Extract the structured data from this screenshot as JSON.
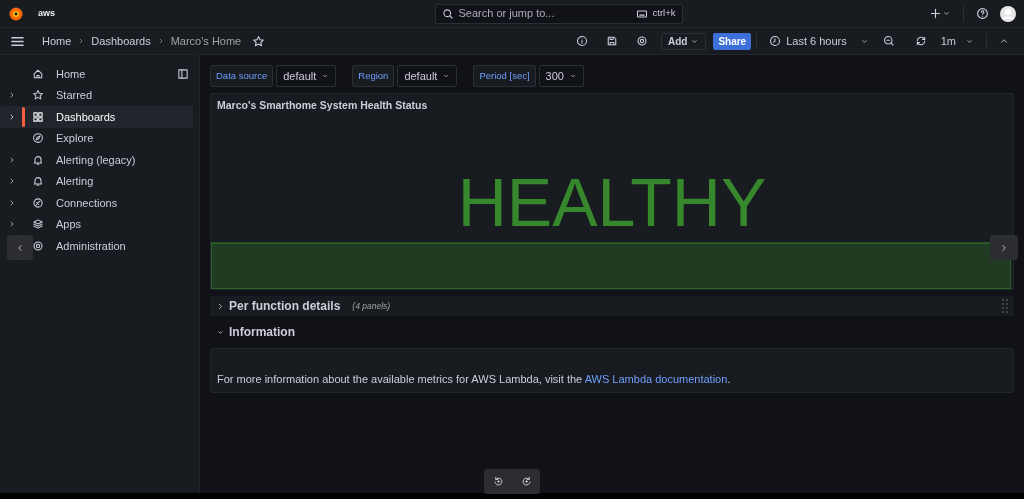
{
  "topbar": {
    "logo_text": "aws",
    "search": {
      "placeholder": "Search or jump to..."
    },
    "shortcut": "ctrl+k"
  },
  "breadcrumbs": [
    {
      "label": "Home",
      "current": false
    },
    {
      "label": "Dashboards",
      "current": false
    },
    {
      "label": "Marco's Home",
      "current": true
    }
  ],
  "toolbar": {
    "add_button": "Add",
    "share_button": "Share",
    "time_range": "Last 6 hours",
    "refresh_interval": "1m"
  },
  "sidebar": {
    "items": [
      {
        "label": "Home",
        "selected": false,
        "expandable": false
      },
      {
        "label": "Starred",
        "selected": false,
        "expandable": true
      },
      {
        "label": "Dashboards",
        "selected": true,
        "expandable": true
      },
      {
        "label": "Explore",
        "selected": false,
        "expandable": false
      },
      {
        "label": "Alerting (legacy)",
        "selected": false,
        "expandable": true
      },
      {
        "label": "Alerting",
        "selected": false,
        "expandable": true
      },
      {
        "label": "Connections",
        "selected": false,
        "expandable": true
      },
      {
        "label": "Apps",
        "selected": false,
        "expandable": true
      },
      {
        "label": "Administration",
        "selected": false
      }
    ]
  },
  "variables": [
    {
      "label": "Data source",
      "value": "default"
    },
    {
      "label": "Region",
      "value": "default"
    },
    {
      "label": "Period [sec]",
      "value": "300"
    }
  ],
  "panel": {
    "title": "Marco's Smarthome System Health Status",
    "value": "HEALTHY",
    "color": "#37872d"
  },
  "rows": [
    {
      "title": "Per function details",
      "expanded": false,
      "note": "(4 panels)"
    },
    {
      "title": "Information",
      "expanded": true
    }
  ],
  "text_panel": {
    "text": "For more information about the available metrics for AWS Lambda, visit the ",
    "link": "AWS Lambda documentation",
    "suffix": "."
  }
}
